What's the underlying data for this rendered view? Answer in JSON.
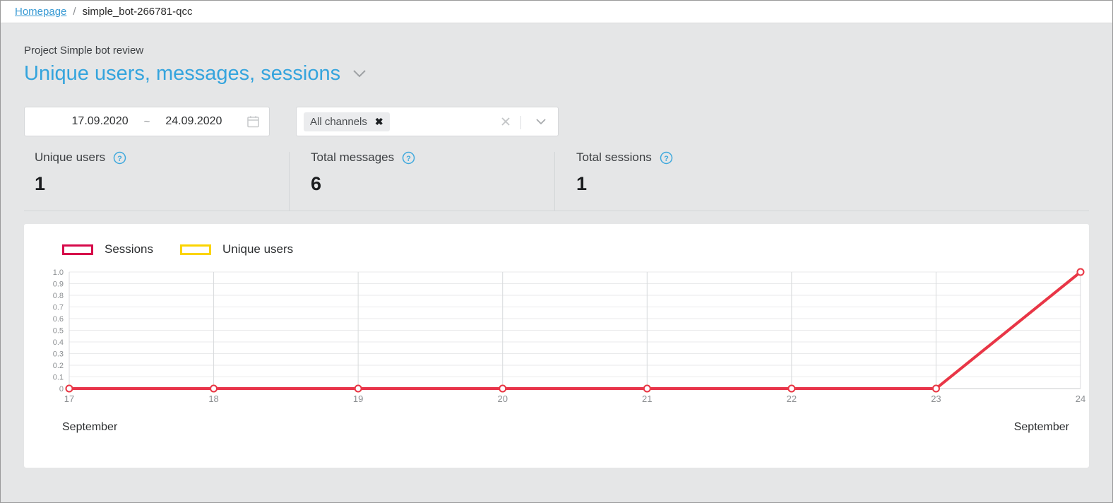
{
  "breadcrumb": {
    "home_label": "Homepage",
    "separator": "/",
    "current": "simple_bot-266781-qcc"
  },
  "header": {
    "project_label": "Project Simple bot review",
    "report_title": "Unique users, messages, sessions",
    "chevron_icon": "chevron-down-icon"
  },
  "filters": {
    "date_from": "17.09.2020",
    "date_separator": "~",
    "date_to": "24.09.2020",
    "calendar_icon": "calendar-icon",
    "channels_chip": "All channels",
    "chip_remove_icon": "close-icon",
    "clear_icon": "clear-icon",
    "dropdown_icon": "chevron-down-icon"
  },
  "kpis": [
    {
      "label": "Unique users",
      "value": "1",
      "help_icon": "help-circle-icon"
    },
    {
      "label": "Total messages",
      "value": "6",
      "help_icon": "help-circle-icon"
    },
    {
      "label": "Total sessions",
      "value": "1",
      "help_icon": "help-circle-icon"
    }
  ],
  "colors": {
    "sessions": "#d6094a",
    "sessions_line": "#e8344a",
    "unique_users": "#fbd400",
    "accent": "#34a4dd",
    "page_bg": "#e5e6e7",
    "grid": "#e9eaeb"
  },
  "chart_footer": {
    "left_month": "September",
    "right_month": "September"
  },
  "chart_data": {
    "type": "line",
    "title": "",
    "xlabel": "September",
    "ylabel": "",
    "grid": true,
    "legend_position": "top-left",
    "x": [
      17,
      18,
      19,
      20,
      21,
      22,
      23,
      24
    ],
    "xtick_labels": [
      "17",
      "18",
      "19",
      "20",
      "21",
      "22",
      "23",
      "24"
    ],
    "ylim": [
      0,
      1.0
    ],
    "ytick_labels": [
      "0",
      "0.1",
      "0.2",
      "0.3",
      "0.4",
      "0.5",
      "0.6",
      "0.7",
      "0.8",
      "0.9",
      "1.0"
    ],
    "ytick_values": [
      0,
      0.1,
      0.2,
      0.3,
      0.4,
      0.5,
      0.6,
      0.7,
      0.8,
      0.9,
      1.0
    ],
    "series": [
      {
        "name": "Sessions",
        "color": "#e8344a",
        "values": [
          0,
          0,
          0,
          0,
          0,
          0,
          0,
          1.0
        ]
      },
      {
        "name": "Unique users",
        "color": "#fbd400",
        "values": [
          0,
          0,
          0,
          0,
          0,
          0,
          0,
          1.0
        ]
      }
    ]
  }
}
